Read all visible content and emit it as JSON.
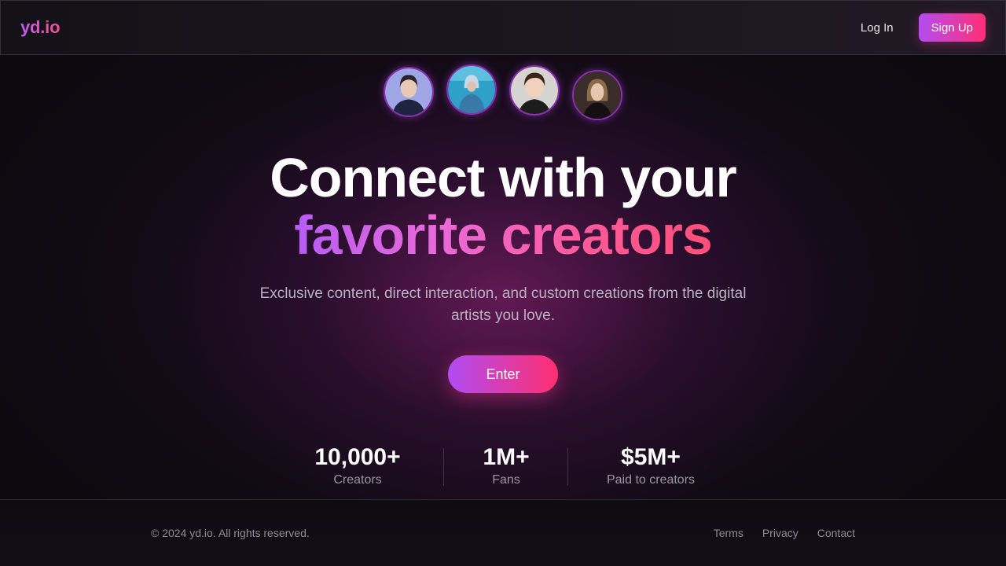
{
  "header": {
    "logo": "yd.io",
    "login_label": "Log In",
    "signup_label": "Sign Up"
  },
  "avatars": [
    {
      "name": "creator-avatar-1"
    },
    {
      "name": "creator-avatar-2"
    },
    {
      "name": "creator-avatar-3"
    },
    {
      "name": "creator-avatar-4"
    }
  ],
  "hero": {
    "headline_line1": "Connect with your",
    "headline_line2": "favorite creators",
    "subtitle": "Exclusive content, direct interaction, and custom creations from the digital artists you love.",
    "cta_label": "Enter"
  },
  "stats": [
    {
      "value": "10,000+",
      "label": "Creators"
    },
    {
      "value": "1M+",
      "label": "Fans"
    },
    {
      "value": "$5M+",
      "label": "Paid to creators"
    }
  ],
  "footer": {
    "copyright": "© 2024 yd.io. All rights reserved.",
    "links": [
      "Terms",
      "Privacy",
      "Contact"
    ]
  },
  "colors": {
    "accent_purple": "#b44cf2",
    "accent_pink": "#ff2f74",
    "background": "#0c0a0f"
  }
}
